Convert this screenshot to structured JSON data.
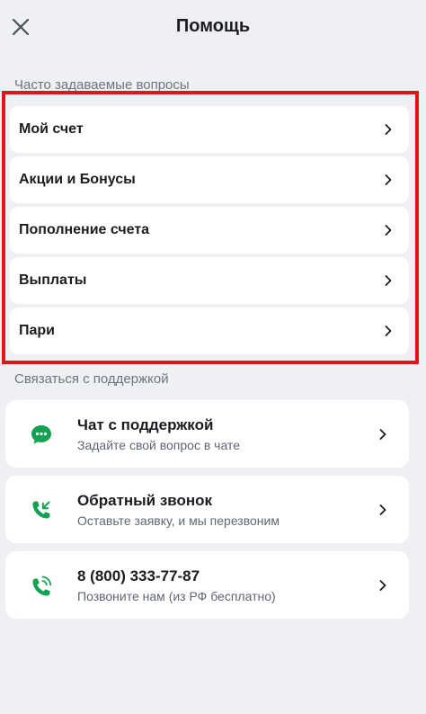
{
  "header": {
    "title": "Помощь",
    "close_icon": "close-icon"
  },
  "faq": {
    "section_label": "Часто задаваемые вопросы",
    "items": [
      {
        "label": "Мой счет"
      },
      {
        "label": "Акции и Бонусы"
      },
      {
        "label": "Пополнение счета"
      },
      {
        "label": "Выплаты"
      },
      {
        "label": "Пари"
      }
    ],
    "highlight_color": "#e2141b"
  },
  "support": {
    "section_label": "Связаться с поддержкой",
    "items": [
      {
        "title": "Чат с поддержкой",
        "subtitle": "Задайте свой вопрос в чате",
        "icon": "chat-icon"
      },
      {
        "title": "Обратный звонок",
        "subtitle": "Оставьте заявку, и мы перезвоним",
        "icon": "incoming-call-icon"
      },
      {
        "title": "8 (800) 333-77-87",
        "subtitle": "Позвоните нам (из РФ бесплатно)",
        "icon": "phone-ringing-icon"
      }
    ]
  },
  "colors": {
    "accent_green": "#12a251",
    "background": "#eef0f3",
    "card": "#ffffff"
  }
}
